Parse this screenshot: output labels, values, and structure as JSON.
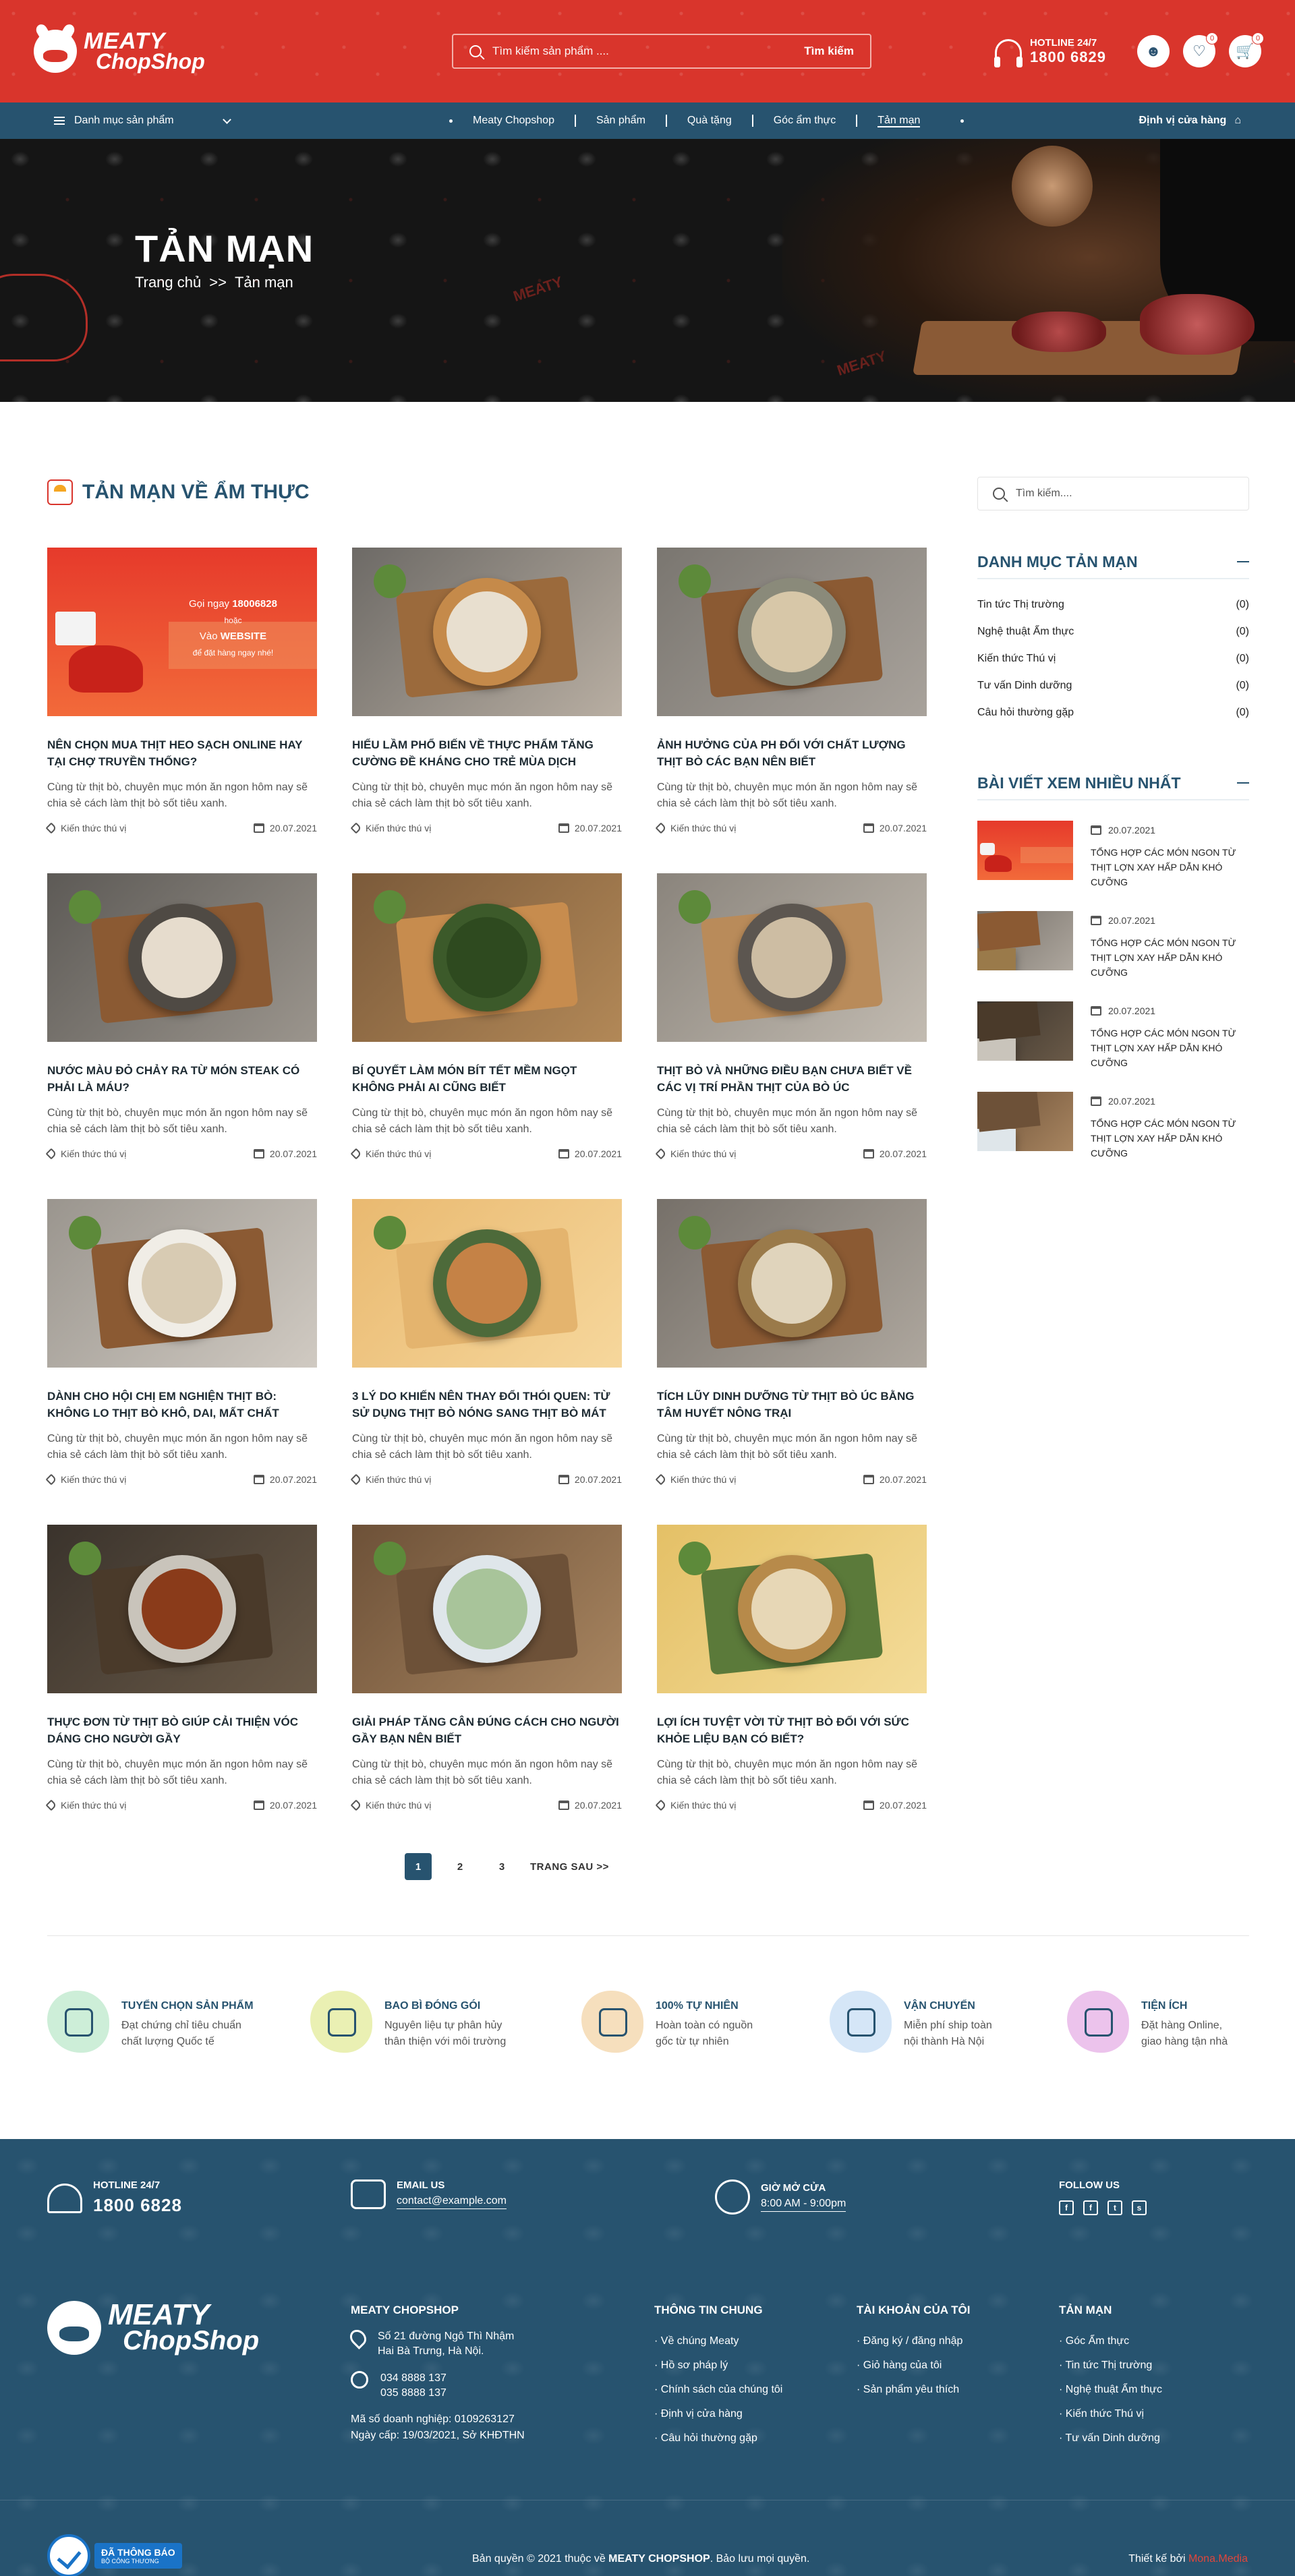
{
  "header": {
    "logo_line1": "MEATY",
    "logo_line2": "ChopShop",
    "search_placeholder": "Tìm kiếm sản phẩm ....",
    "search_button": "Tìm kiếm",
    "hotline_label": "HOTLINE 24/7",
    "hotline_number": "1800 6829",
    "wishlist_count": "0",
    "cart_count": "0"
  },
  "nav": {
    "category_menu": "Danh mục sản phẩm",
    "items": [
      "Meaty Chopshop",
      "Sản phẩm",
      "Quà tặng",
      "Góc ẩm thực",
      "Tản mạn"
    ],
    "active_index": 4,
    "store_locator": "Định vị cửa hàng"
  },
  "hero": {
    "title": "TẢN MẠN",
    "breadcrumb_home": "Trang chủ",
    "breadcrumb_separator": ">>",
    "breadcrumb_current": "Tản mạn",
    "watermark": "MEATY"
  },
  "section": {
    "title": "TẢN MẠN VỀ ẨM THỰC"
  },
  "posts": [
    {
      "title": "Nên chọn mua thịt heo sạch online hay tại chợ truyền thống?",
      "excerpt": "Cùng từ thịt bò, chuyên mục món ăn ngon hôm nay sẽ chia sẻ cách làm thịt bò sốt tiêu xanh.",
      "tag": "Kiến thức thú vị",
      "date": "20.07.2021",
      "image": "delivery-banner",
      "banner_text1": "Gọi ngay",
      "banner_phone": "18006828",
      "banner_text2": "hoặc",
      "banner_text3": "Vào",
      "banner_website": "WEBSITE",
      "banner_text4": "để đặt hàng ngay nhé!"
    },
    {
      "title": "Hiểu lầm phổ biến về thực phẩm tăng cường đề kháng cho trẻ mùa dịch",
      "excerpt": "Cùng từ thịt bò, chuyên mục món ăn ngon hôm nay sẽ chia sẻ cách làm thịt bò sốt tiêu xanh.",
      "tag": "Kiến thức thú vị",
      "date": "20.07.2021",
      "image": "pho-bowl"
    },
    {
      "title": "Ảnh hưởng của pH đối với chất lượng thịt bò các bạn nên biết",
      "excerpt": "Cùng từ thịt bò, chuyên mục món ăn ngon hôm nay sẽ chia sẻ cách làm thịt bò sốt tiêu xanh.",
      "tag": "Kiến thức thú vị",
      "date": "20.07.2021",
      "image": "beef-dish"
    },
    {
      "title": "Nước màu đỏ chảy ra từ món steak có phải là máu?",
      "excerpt": "Cùng từ thịt bò, chuyên mục món ăn ngon hôm nay sẽ chia sẻ cách làm thịt bò sốt tiêu xanh.",
      "tag": "Kiến thức thú vị",
      "date": "20.07.2021",
      "image": "porridge"
    },
    {
      "title": "Bí quyết làm món bít tết mềm ngọt không phải ai cũng biết",
      "excerpt": "Cùng từ thịt bò, chuyên mục món ăn ngon hôm nay sẽ chia sẻ cách làm thịt bò sốt tiêu xanh.",
      "tag": "Kiến thức thú vị",
      "date": "20.07.2021",
      "image": "leaf-rolls"
    },
    {
      "title": "Thịt bò và những điều bạn chưa biết về các vị trí phần thịt của bò Úc",
      "excerpt": "Cùng từ thịt bò, chuyên mục món ăn ngon hôm nay sẽ chia sẻ cách làm thịt bò sốt tiêu xanh.",
      "tag": "Kiến thức thú vị",
      "date": "20.07.2021",
      "image": "soup-set"
    },
    {
      "title": "Dành cho hội chị em nghiện thịt bò: Không lo thịt bò khô, dai, mất chất",
      "excerpt": "Cùng từ thịt bò, chuyên mục món ăn ngon hôm nay sẽ chia sẻ cách làm thịt bò sốt tiêu xanh.",
      "tag": "Kiến thức thú vị",
      "date": "20.07.2021",
      "image": "dumplings"
    },
    {
      "title": "3 lý do khiến nên thay đổi thói quen: Từ sử dụng thịt bò nóng sang thịt bò mát",
      "excerpt": "Cùng từ thịt bò, chuyên mục món ăn ngon hôm nay sẽ chia sẻ cách làm thịt bò sốt tiêu xanh.",
      "tag": "Kiến thức thú vị",
      "date": "20.07.2021",
      "image": "grilled-meat"
    },
    {
      "title": "Tích lũy dinh dưỡng từ thịt bò Úc bằng tâm huyết nông trại",
      "excerpt": "Cùng từ thịt bò, chuyên mục món ăn ngon hôm nay sẽ chia sẻ cách làm thịt bò sốt tiêu xanh.",
      "tag": "Kiến thức thú vị",
      "date": "20.07.2021",
      "image": "noodle-bowl"
    },
    {
      "title": "Thực đơn từ thịt bò giúp cải thiện vóc dáng cho người gầy",
      "excerpt": "Cùng từ thịt bò, chuyên mục món ăn ngon hôm nay sẽ chia sẻ cách làm thịt bò sốt tiêu xanh.",
      "tag": "Kiến thức thú vị",
      "date": "20.07.2021",
      "image": "stir-fry"
    },
    {
      "title": "Giải pháp tăng cân đúng cách cho người gầy bạn nên biết",
      "excerpt": "Cùng từ thịt bò, chuyên mục món ăn ngon hôm nay sẽ chia sẻ cách làm thịt bò sốt tiêu xanh.",
      "tag": "Kiến thức thú vị",
      "date": "20.07.2021",
      "image": "spring-rolls"
    },
    {
      "title": "Lợi ích tuyệt vời từ thịt bò đối với sức khỏe liệu bạn có biết?",
      "excerpt": "Cùng từ thịt bò, chuyên mục món ăn ngon hôm nay sẽ chia sẻ cách làm thịt bò sốt tiêu xanh.",
      "tag": "Kiến thức thú vị",
      "date": "20.07.2021",
      "image": "rice-basket"
    }
  ],
  "pagination": {
    "pages": [
      "1",
      "2",
      "3"
    ],
    "current": "1",
    "next": "TRANG SAU >>"
  },
  "sidebar": {
    "search_placeholder": "Tìm kiếm....",
    "categories_title": "DANH MỤC TẢN MẠN",
    "categories": [
      {
        "name": "Tin tức Thị trường",
        "count": "(0)"
      },
      {
        "name": "Nghệ thuật Ẩm thực",
        "count": "(0)"
      },
      {
        "name": "Kiến thức Thú vị",
        "count": "(0)"
      },
      {
        "name": "Tư vấn Dinh dưỡng",
        "count": "(0)"
      },
      {
        "name": "Câu hỏi thường gặp",
        "count": "(0)"
      }
    ],
    "popular_title": "BÀI VIẾT XEM NHIỀU NHẤT",
    "popular": [
      {
        "date": "20.07.2021",
        "title": "Tổng hợp các món ngon từ thịt lợn xay hấp dẫn khó cưỡng",
        "image": "delivery-banner"
      },
      {
        "date": "20.07.2021",
        "title": "Tổng hợp các món ngon từ thịt lợn xay hấp dẫn khó cưỡng",
        "image": "noodle-bowl"
      },
      {
        "date": "20.07.2021",
        "title": "Tổng hợp các món ngon từ thịt lợn xay hấp dẫn khó cưỡng",
        "image": "stir-fry"
      },
      {
        "date": "20.07.2021",
        "title": "Tổng hợp các món ngon từ thịt lợn xay hấp dẫn khó cưỡng",
        "image": "spring-rolls"
      }
    ]
  },
  "features": [
    {
      "title": "TUYỂN CHỌN SẢN PHẨM",
      "line1": "Đạt chứng chỉ tiêu chuẩn",
      "line2": "chất lượng Quốc tế",
      "color": "#cdeed8"
    },
    {
      "title": "BAO BÌ ĐÓNG GÓI",
      "line1": "Nguyên liệu tự phân hủy",
      "line2": "thân thiện với môi trường",
      "color": "#eaf0b3"
    },
    {
      "title": "100% TỰ NHIÊN",
      "line1": "Hoàn toàn có nguồn",
      "line2": "gốc từ tự nhiên",
      "color": "#f6dfbd"
    },
    {
      "title": "VẬN CHUYỂN",
      "line1": "Miễn phí ship toàn",
      "line2": "nội thành Hà Nội",
      "color": "#d5e6f7"
    },
    {
      "title": "TIỆN ÍCH",
      "line1": "Đặt hàng Online,",
      "line2": "giao hàng tận nhà",
      "color": "#ecc3ec"
    }
  ],
  "footer": {
    "hotline_label": "HOTLINE 24/7",
    "hotline": "1800 6828",
    "email_label": "EMAIL US",
    "email": "contact@example.com",
    "hours_label": "GIỜ MỞ CỬA",
    "hours": "8:00 AM - 9:00pm",
    "follow_label": "FOLLOW US",
    "social": [
      "f",
      "f",
      "t",
      "s"
    ],
    "company_title": "MEATY CHOPSHOP",
    "address_line1": "Số 21 đường Ngô Thì Nhậm",
    "address_line2": "Hai Bà Trưng, Hà Nội.",
    "phone1": "034 8888 137",
    "phone2": "035 8888 137",
    "biz_line1": "Mã số doanh nghiệp: 0109263127",
    "biz_line2": "Ngày cấp: 19/03/2021, Sở KHĐTHN",
    "col1_title": "THÔNG TIN CHUNG",
    "col1": [
      "Về chúng Meaty",
      "Hồ sơ pháp lý",
      "Chính sách của chúng tôi",
      "Định vị cửa hàng",
      "Câu hỏi thường gặp"
    ],
    "col2_title": "TÀI KHOẢN CỦA TÔI",
    "col2": [
      "Đăng ký / đăng nhập",
      "Giỏ hàng của tôi",
      "Sản phẩm yêu thích"
    ],
    "col3_title": "TẢN MẠN",
    "col3": [
      "Góc Ẩm thực",
      "Tin tức Thị trường",
      "Nghệ thuật Ẩm thực",
      "Kiến thức Thú vị",
      "Tư vấn Dinh dưỡng"
    ],
    "bct_line1": "ĐÃ THÔNG BÁO",
    "bct_line2": "BỘ CÔNG THƯƠNG",
    "copyright_pre": "Bản quyền © 2021 thuộc về ",
    "copyright_brand": "MEATY CHOPSHOP",
    "copyright_post": ". Bảo lưu mọi quyền.",
    "credit_pre": "Thiết kế bởi ",
    "credit_brand": "Mona.Media"
  }
}
